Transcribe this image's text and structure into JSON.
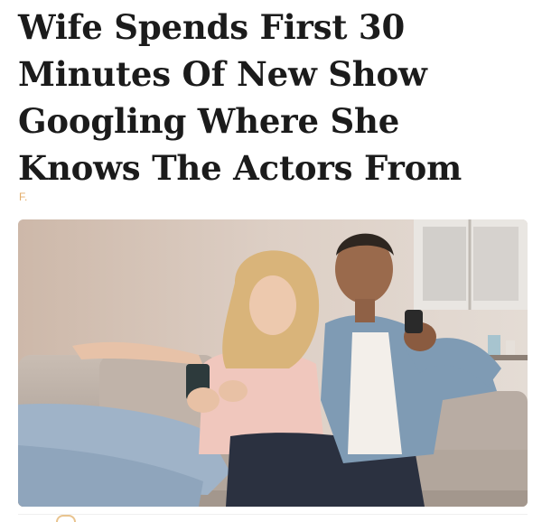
{
  "article": {
    "headline": "Wife Spends First 30 Minutes Of New Show Googling Where She Knows The Actors From",
    "byline": "F."
  },
  "photo": {
    "icons": [
      "couch",
      "woman-holding-phone",
      "man-holding-remote",
      "window",
      "wall-shelf"
    ],
    "colors": {
      "wall": "#d9c9bd",
      "couch": "#bfb3aa",
      "woman_top": "#f0c7bd",
      "woman_jeans": "#9fb3c8",
      "man_jacket": "#7f9bb4",
      "man_jeans": "#2b3140"
    }
  }
}
